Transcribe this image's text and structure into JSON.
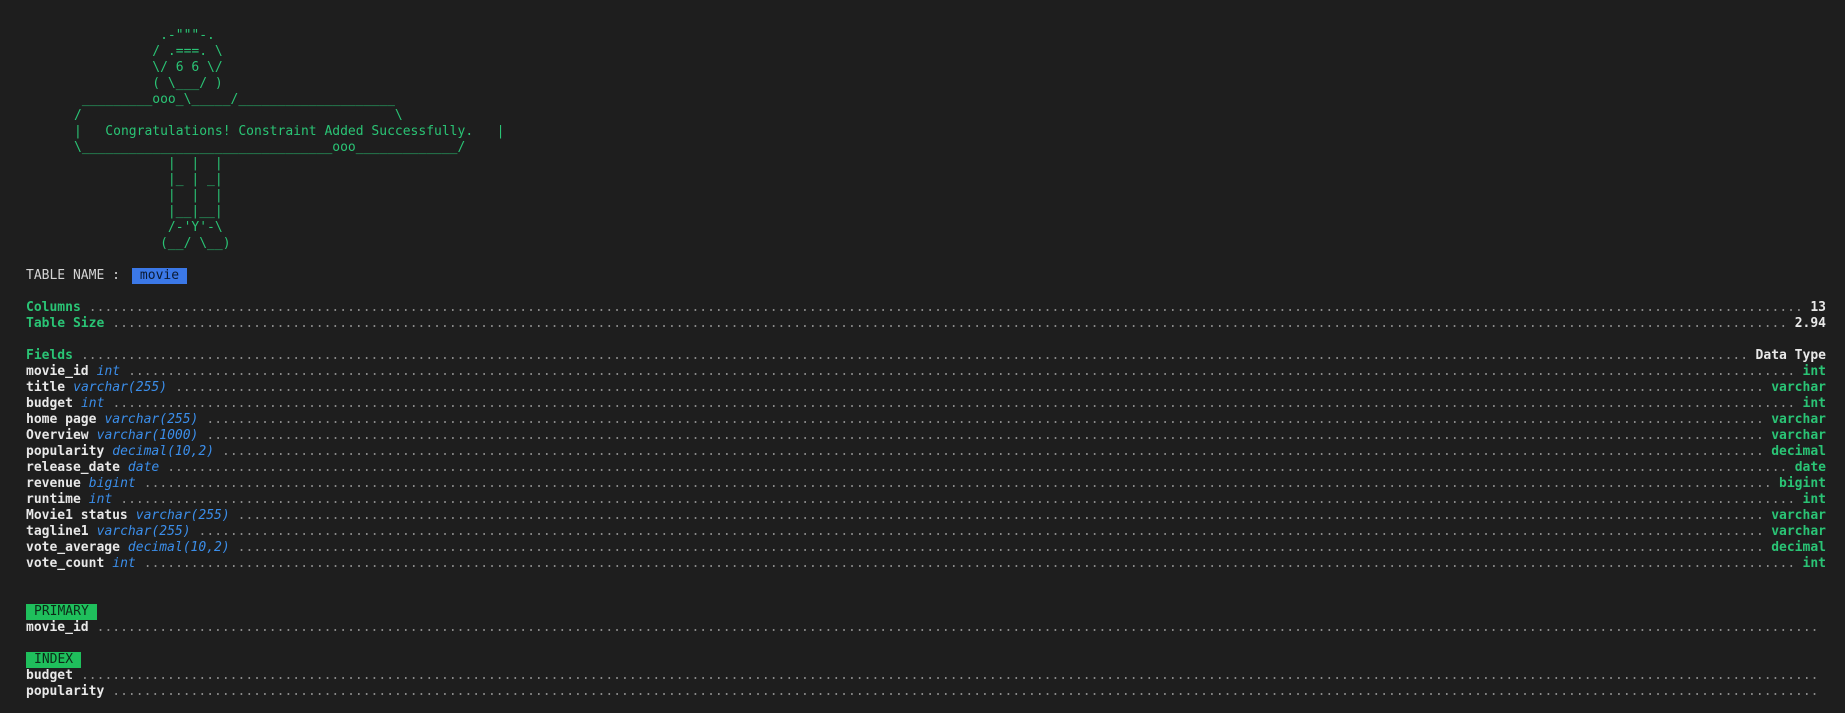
{
  "banner": {
    "art": "           .-\"\"\"-.\n          / .===. \\\n          \\/ 6 6 \\/\n          ( \\___/ )\n _________ooo_\\_____/____________________\n/                                        \\\n|   Congratulations! Constraint Added Successfully.   |\n\\________________________________ooo_____________/\n            |  |  |\n            |_ | _|\n            |  |  |\n            |__|__|\n            /-'Y'-\\\n           (__/ \\__)"
  },
  "table": {
    "name_label": "TABLE NAME :",
    "name": "movie"
  },
  "stats": [
    {
      "label": "Columns",
      "value": "13"
    },
    {
      "label": "Table Size",
      "value": "2.94"
    }
  ],
  "fields_header": {
    "label": "Fields",
    "value": "Data Type"
  },
  "fields": [
    {
      "name": "movie_id",
      "type": "int",
      "base": "int"
    },
    {
      "name": "title",
      "type": "varchar(255)",
      "base": "varchar"
    },
    {
      "name": "budget",
      "type": "int",
      "base": "int"
    },
    {
      "name": "home page",
      "type": "varchar(255)",
      "base": "varchar"
    },
    {
      "name": "Overview",
      "type": "varchar(1000)",
      "base": "varchar"
    },
    {
      "name": "popularity",
      "type": "decimal(10,2)",
      "base": "decimal"
    },
    {
      "name": "release_date",
      "type": "date",
      "base": "date"
    },
    {
      "name": "revenue",
      "type": "bigint",
      "base": "bigint"
    },
    {
      "name": "runtime",
      "type": "int",
      "base": "int"
    },
    {
      "name": "Movie1 status",
      "type": "varchar(255)",
      "base": "varchar"
    },
    {
      "name": "tagline1",
      "type": "varchar(255)",
      "base": "varchar"
    },
    {
      "name": "vote_average",
      "type": "decimal(10,2)",
      "base": "decimal"
    },
    {
      "name": "vote_count",
      "type": "int",
      "base": "int"
    }
  ],
  "primary": {
    "badge": "PRIMARY",
    "fields": [
      "movie_id"
    ]
  },
  "index": {
    "badge": "INDEX",
    "fields": [
      "budget",
      "popularity"
    ]
  },
  "colors": {
    "background": "#1e1e1e",
    "green": "#2ac475",
    "blue": "#3b8eea",
    "badge_green": "#1fbf5c",
    "badge_blue": "#3b78e7"
  }
}
